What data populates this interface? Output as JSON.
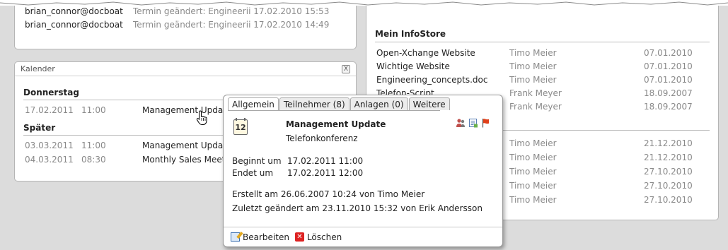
{
  "mail": {
    "rows": [
      {
        "from": "brian_connor@docboat",
        "subject": "Termin geändert: Engineerii 17.02.2010 15:53"
      },
      {
        "from": "brian_connor@docboat",
        "subject": "Termin geändert: Engineerii 17.02.2010 14:49"
      }
    ]
  },
  "calendar": {
    "title": "Kalender",
    "close": "X",
    "sections": [
      {
        "heading": "Donnerstag",
        "rows": [
          {
            "date": "17.02.2011",
            "time": "11:00",
            "title": "Management Update"
          }
        ]
      },
      {
        "heading": "Später",
        "rows": [
          {
            "date": "03.03.2011",
            "time": "11:00",
            "title": "Management Update"
          },
          {
            "date": "04.03.2011",
            "time": "08:30",
            "title": "Monthly Sales Meetin"
          }
        ]
      }
    ]
  },
  "infostore": {
    "title": "Mein InfoStore",
    "rows": [
      {
        "name": "Open-Xchange Website",
        "owner": "Timo Meier",
        "date": "07.01.2010"
      },
      {
        "name": "Wichtige Website",
        "owner": "Timo Meier",
        "date": "07.01.2010"
      },
      {
        "name": "Engineering_concepts.doc",
        "owner": "Timo Meier",
        "date": "07.01.2010"
      },
      {
        "name": "Telefon-Script",
        "owner": "Frank Meyer",
        "date": "18.09.2007"
      },
      {
        "name": "",
        "owner": "Frank Meyer",
        "date": "18.09.2007"
      }
    ],
    "rows2": [
      {
        "owner": "Timo Meier",
        "date": "21.12.2010"
      },
      {
        "owner": "Timo Meier",
        "date": "21.12.2010"
      },
      {
        "owner": "Timo Meier",
        "date": "27.10.2010"
      },
      {
        "owner": "Timo Meier",
        "date": "27.10.2010"
      },
      {
        "owner": "Timo Meier",
        "date": "27.10.2010"
      }
    ]
  },
  "popup": {
    "tabs": [
      "Allgemein",
      "Teilnehmer (8)",
      "Anlagen (0)",
      "Weitere"
    ],
    "icon_day": "12",
    "title": "Management Update",
    "subtitle": "Telefonkonferenz",
    "begins_label": "Beginnt um",
    "begins_value": "17.02.2011 11:00",
    "ends_label": "Endet um",
    "ends_value": "17.02.2011 12:00",
    "created": "Erstellt am 26.06.2007 10:24 von Timo Meier",
    "modified": "Zuletzt geändert am 23.11.2010 15:32 von Erik Andersson",
    "edit_label": "Bearbeiten",
    "delete_label": "Löschen"
  },
  "icons": {
    "participants": "participants-icon",
    "notes": "notes-icon",
    "flag": "flag-icon",
    "flag_color": "#e0401a"
  }
}
